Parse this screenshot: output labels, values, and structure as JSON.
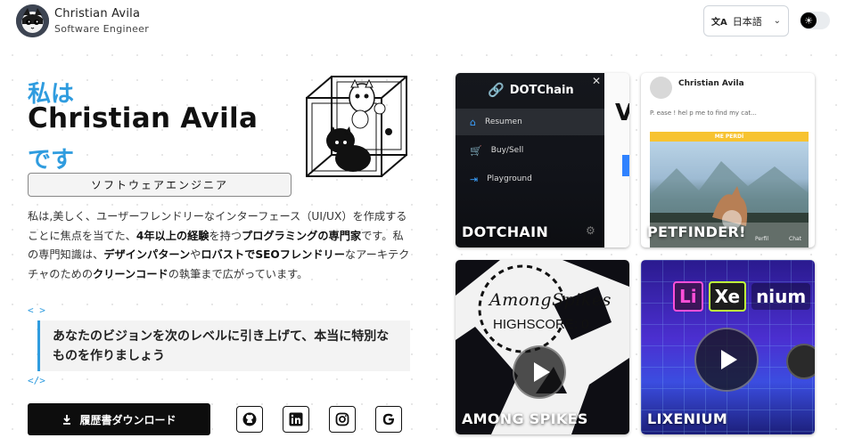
{
  "header": {
    "name": "Christian Avila",
    "role": "Software Engineer",
    "language": "日本語",
    "language_icon": "translate-icon",
    "theme_icon": "sun-icon"
  },
  "hero": {
    "line1": "私は",
    "line2": "Christian Avila",
    "line3": "です",
    "role_box": "ソフトウェアエンジニア",
    "bio": {
      "p1": "私は,美しく、ユーザーフレンドリーなインターフェース（UI/UX）を作成することに焦点を当てた、",
      "p1_bold": "4年以上の経験",
      "p2": "を持つ",
      "p2_bold": "プログラミングの専門家",
      "p3": "です。私の専門知識は、",
      "p3_bold": "デザインパターン",
      "p4": "や",
      "p4_bold": "ロバストでSEOフレンドリー",
      "p5": "なアーキテクチャのための",
      "p5_bold": "クリーンコード",
      "p6": "の執筆まで広がっています。"
    },
    "code_open": "< >",
    "quote": "あなたのビジョンを次のレベルに引き上げて、本当に特別なものを作りましょう",
    "code_close": "</>",
    "download_label": "履歴書ダウンロード",
    "social_icons": [
      "github-icon",
      "linkedin-icon",
      "instagram-icon",
      "google-icon"
    ]
  },
  "projects": {
    "dotchain": {
      "title": "DOTCHAIN",
      "brand": "DOTChain",
      "close": "✕",
      "menu": [
        "Resumen",
        "Buy/Sell",
        "Playground"
      ],
      "main_letter": "V"
    },
    "petfinder": {
      "title": "PETFINDER!",
      "user": "Christian Avila",
      "post_text": "P. ease ! hel p me to find my cat...",
      "banner": "ME PERDÍ",
      "nav": [
        "Perfil",
        "Chat"
      ]
    },
    "among": {
      "title": "AMONG SPIKES",
      "logo": "AmongSpikes",
      "score": "HIGHSCORE: 0"
    },
    "lixenium": {
      "title": "LIXENIUM",
      "logo": [
        "Li",
        "Xe",
        "nium"
      ]
    }
  },
  "colors": {
    "accent": "#2f9cdf",
    "button": "#0d0d0d"
  }
}
